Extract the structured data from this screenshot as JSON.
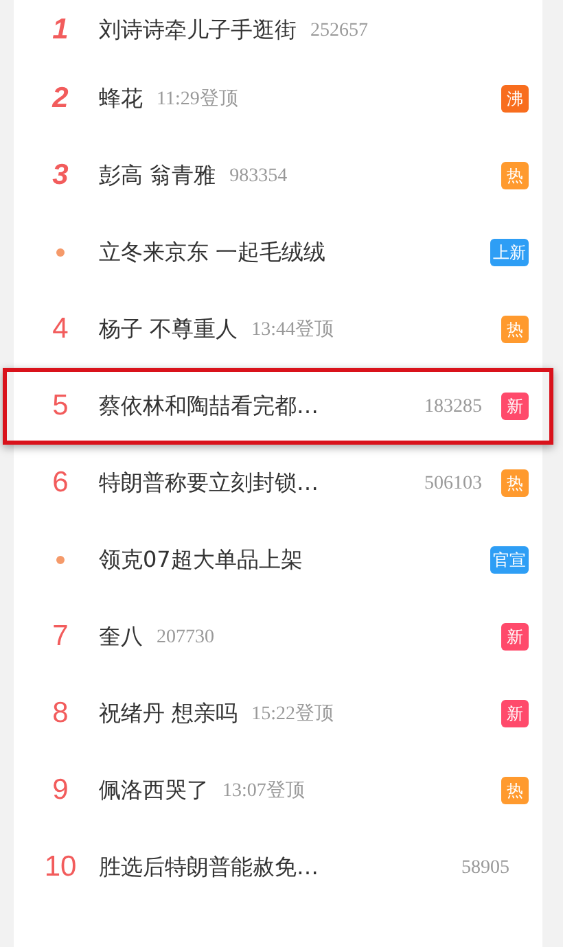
{
  "hot_list": [
    {
      "kind": "top",
      "rank": "1",
      "title": "刘诗诗牵儿子手逛街",
      "info": "252657",
      "highlighted": false
    },
    {
      "kind": "top",
      "rank": "2",
      "title": "蜂花",
      "info": "11:29登顶",
      "badge": {
        "label": "沸",
        "color": "#f86d1e"
      },
      "highlighted": false
    },
    {
      "kind": "top",
      "rank": "3",
      "title": "彭高 翁青雅",
      "info": "983354",
      "badge": {
        "label": "热",
        "color": "#ff9a2e"
      },
      "highlighted": false
    },
    {
      "kind": "promo",
      "title": "立冬来京东 一起毛绒绒",
      "badge": {
        "label": "上新",
        "color": "#2e9ef5"
      },
      "highlighted": false
    },
    {
      "kind": "rank",
      "rank": "4",
      "title": "杨子 不尊重人",
      "info": "13:44登顶",
      "badge": {
        "label": "热",
        "color": "#ff9a2e"
      },
      "highlighted": false
    },
    {
      "kind": "rank",
      "rank": "5",
      "title": "蔡依林和陶喆看完都…",
      "info": "183285",
      "badge": {
        "label": "新",
        "color": "#ff4a6b"
      },
      "highlighted": true
    },
    {
      "kind": "rank",
      "rank": "6",
      "title": "特朗普称要立刻封锁…",
      "info": "506103",
      "badge": {
        "label": "热",
        "color": "#ff9a2e"
      },
      "highlighted": false
    },
    {
      "kind": "promo",
      "title": "领克07超大单品上架",
      "badge": {
        "label": "官宣",
        "color": "#2e9ef5"
      },
      "highlighted": false
    },
    {
      "kind": "rank",
      "rank": "7",
      "title": "奎八",
      "info": "207730",
      "badge": {
        "label": "新",
        "color": "#ff4a6b"
      },
      "highlighted": false
    },
    {
      "kind": "rank",
      "rank": "8",
      "title": "祝绪丹 想亲吗",
      "info": "15:22登顶",
      "badge": {
        "label": "新",
        "color": "#ff4a6b"
      },
      "highlighted": false
    },
    {
      "kind": "rank",
      "rank": "9",
      "title": "佩洛西哭了",
      "info": "13:07登顶",
      "badge": {
        "label": "热",
        "color": "#ff9a2e"
      },
      "highlighted": false
    },
    {
      "kind": "rank",
      "rank": "10",
      "title": "胜选后特朗普能赦免…",
      "info": "58905",
      "highlighted": false
    }
  ]
}
